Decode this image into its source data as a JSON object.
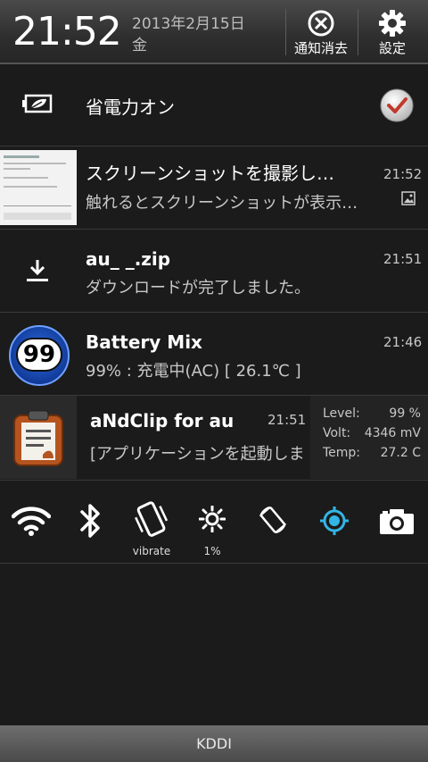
{
  "header": {
    "time": "21:52",
    "date": "2013年2月15日",
    "weekday": "金",
    "clear_label": "通知消去",
    "settings_label": "設定"
  },
  "power_saving": {
    "label": "省電力オン",
    "checked": true
  },
  "notifications": [
    {
      "title": "スクリーンショットを撮影し…",
      "subtitle": "触れるとスクリーンショットが表示…",
      "time": "21:52"
    },
    {
      "title": "au_ _.zip",
      "subtitle": "ダウンロードが完了しました。",
      "time": "21:51"
    },
    {
      "title": "Battery Mix",
      "subtitle": "99% : 充電中(AC) [ 26.1℃ ]",
      "time": "21:46",
      "badge": "99"
    },
    {
      "title": "aNdClip for au",
      "subtitle": "[アプリケーションを起動しま",
      "time": "21:51",
      "stats": [
        {
          "label": "Level:",
          "value": "99 %"
        },
        {
          "label": "Volt:",
          "value": "4346 mV"
        },
        {
          "label": "Temp:",
          "value": "27.2 C"
        }
      ]
    }
  ],
  "quick_settings": {
    "vibrate_label": "vibrate",
    "brightness_label": "1%"
  },
  "footer": {
    "carrier": "KDDI"
  },
  "colors": {
    "accent_blue": "#33b5e5",
    "check_red": "#c0392b"
  }
}
